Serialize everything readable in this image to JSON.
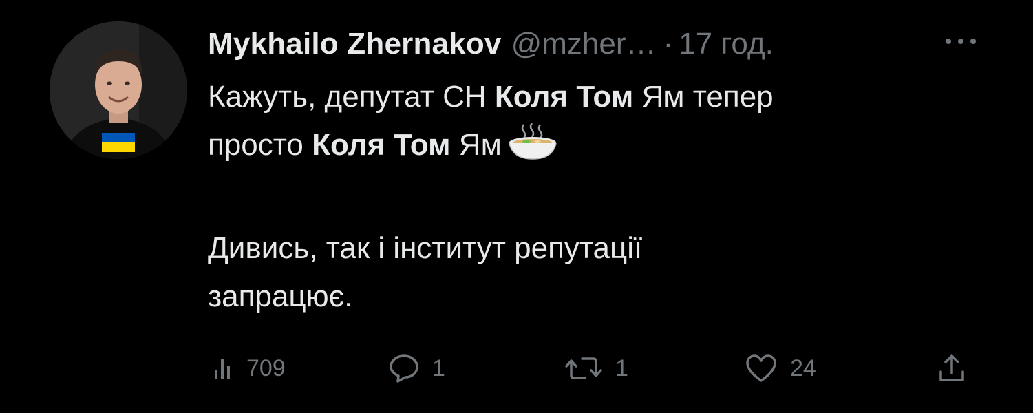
{
  "tweet": {
    "author": {
      "display_name": "Mykhailo Zhernakov",
      "handle": "@mzher…",
      "avatar_icon": "avatar-photo"
    },
    "separator": "·",
    "time": "17 год.",
    "body": {
      "line1_part1": "Кажуть, депутат СН ",
      "line1_bold": "Коля Том",
      "line1_part2": " Ям тепер",
      "line2_part1": "просто ",
      "line2_bold": "Коля Том",
      "line2_part2": " Ям",
      "emoji_icon": "steaming-bowl-icon",
      "line3": "Дивись, так і інститут репутації",
      "line4": "запрацює."
    },
    "actions": {
      "views": "709",
      "replies": "1",
      "reposts": "1",
      "likes": "24"
    }
  },
  "colors": {
    "background": "#000000",
    "text": "#e7e9ea",
    "muted": "#71767b",
    "flag_blue": "#0057b7",
    "flag_yellow": "#ffd700"
  }
}
